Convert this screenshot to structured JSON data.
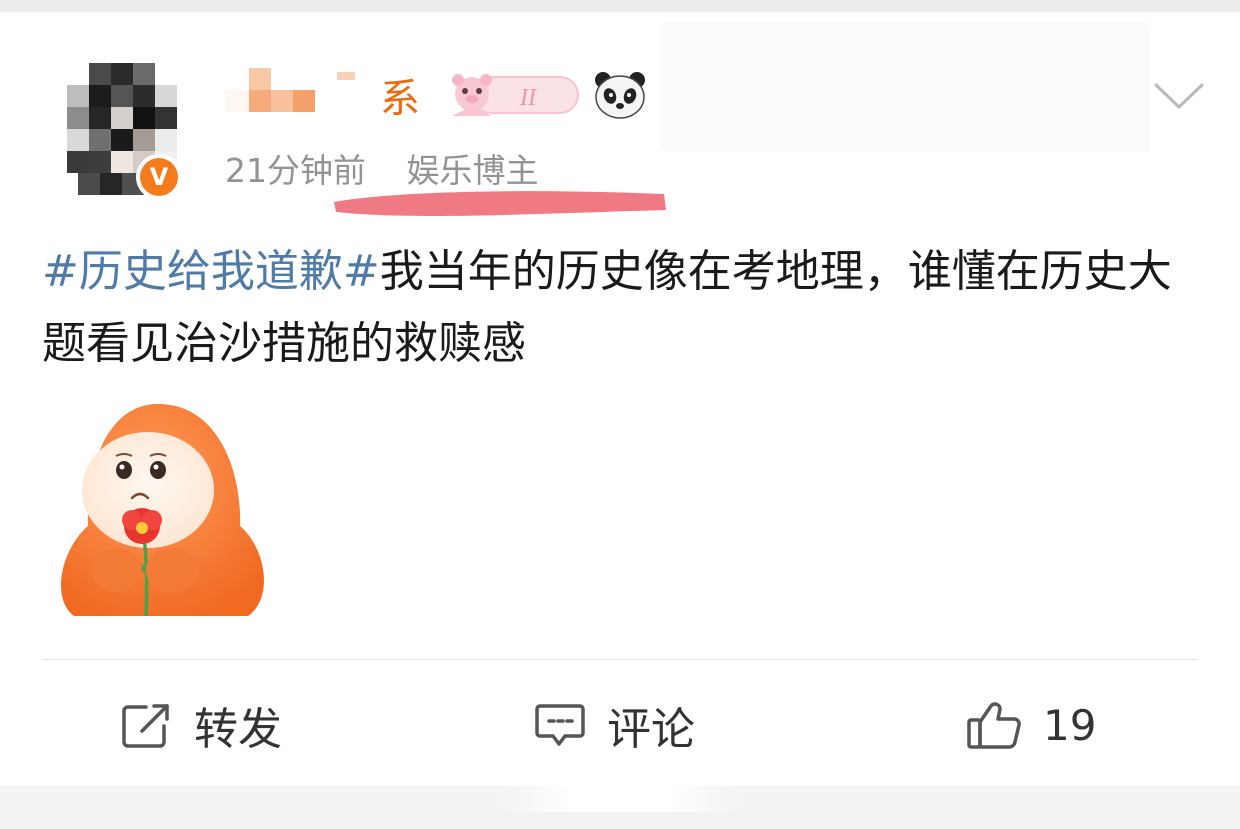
{
  "post": {
    "author": {
      "name_visible_char": "系",
      "verified_label": "V"
    },
    "meta": {
      "time": "21分钟前",
      "role": "娱乐博主"
    },
    "text": {
      "hashtag": "#历史给我道歉#",
      "body": "我当年的历史像在考地理，谁懂在历史大题看见治沙措施的救赎感"
    },
    "actions": {
      "repost_label": "转发",
      "comment_label": "评论",
      "like_count": "19"
    }
  },
  "colors": {
    "hashtag": "#4f7ba6",
    "verified": "#f67b1c",
    "name": "#ee6a0f"
  },
  "icons": [
    "chevron-down-icon",
    "share-icon",
    "comment-icon",
    "thumbs-up-icon",
    "panda-icon",
    "sticker-image"
  ]
}
